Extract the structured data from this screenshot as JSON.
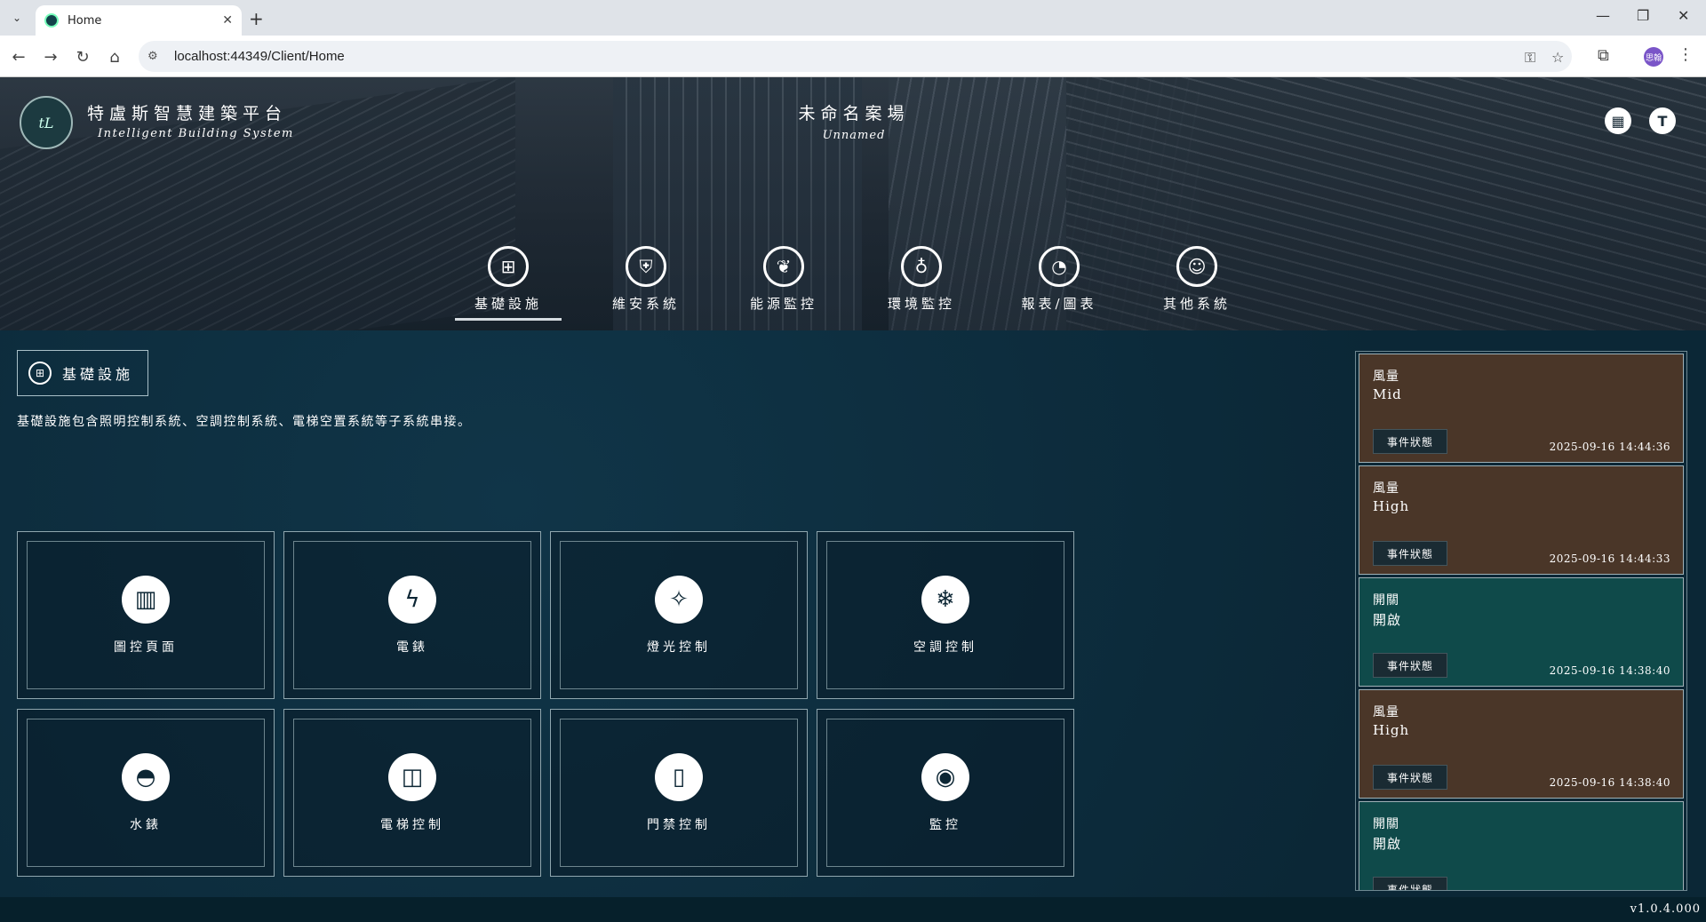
{
  "browser": {
    "tab_title": "Home",
    "url": "localhost:44349/Client/Home",
    "profile_initials": "思翰"
  },
  "header": {
    "logo_text": "tL",
    "brand_title": "特盧斯智慧建築平台",
    "brand_subtitle": "Intelligent Building System",
    "site_title": "未命名案場",
    "site_subtitle": "Unnamed",
    "user_initial": "T"
  },
  "main_nav": [
    {
      "label": "基礎設施",
      "icon": "building-globe-icon"
    },
    {
      "label": "維安系統",
      "icon": "shield-icon"
    },
    {
      "label": "能源監控",
      "icon": "leaf-plug-icon"
    },
    {
      "label": "環境監控",
      "icon": "globe-flame-icon"
    },
    {
      "label": "報表/圖表",
      "icon": "pie-chart-icon"
    },
    {
      "label": "其他系統",
      "icon": "robot-badge-icon"
    }
  ],
  "section": {
    "title": "基礎設施",
    "description": "基礎設施包含照明控制系統、空調控制系統、電梯空置系統等子系統串接。"
  },
  "tiles": [
    {
      "label": "圖控頁面",
      "icon": "building-icon"
    },
    {
      "label": "電錶",
      "icon": "power-meter-icon"
    },
    {
      "label": "燈光控制",
      "icon": "lightbulb-icon"
    },
    {
      "label": "空調控制",
      "icon": "hvac-icon"
    },
    {
      "label": "水錶",
      "icon": "water-meter-icon"
    },
    {
      "label": "電梯控制",
      "icon": "elevator-icon"
    },
    {
      "label": "門禁控制",
      "icon": "door-access-icon"
    },
    {
      "label": "監控",
      "icon": "cctv-icon"
    }
  ],
  "events": [
    {
      "title": "風量",
      "value": "Mid",
      "button": "事件狀態",
      "time": "2025-09-16 14:44:36",
      "color": "#4a3628"
    },
    {
      "title": "風量",
      "value": "High",
      "button": "事件狀態",
      "time": "2025-09-16 14:44:33",
      "color": "#4a3628"
    },
    {
      "title": "開關",
      "value": "開啟",
      "button": "事件狀態",
      "time": "2025-09-16 14:38:40",
      "color": "#0f4a4a"
    },
    {
      "title": "風量",
      "value": "High",
      "button": "事件狀態",
      "time": "2025-09-16 14:38:40",
      "color": "#4a3628"
    },
    {
      "title": "開關",
      "value": "開啟",
      "button": "事件狀態",
      "time": "",
      "color": "#0f4a4a"
    }
  ],
  "footer": {
    "version": "v1.0.4.000"
  }
}
